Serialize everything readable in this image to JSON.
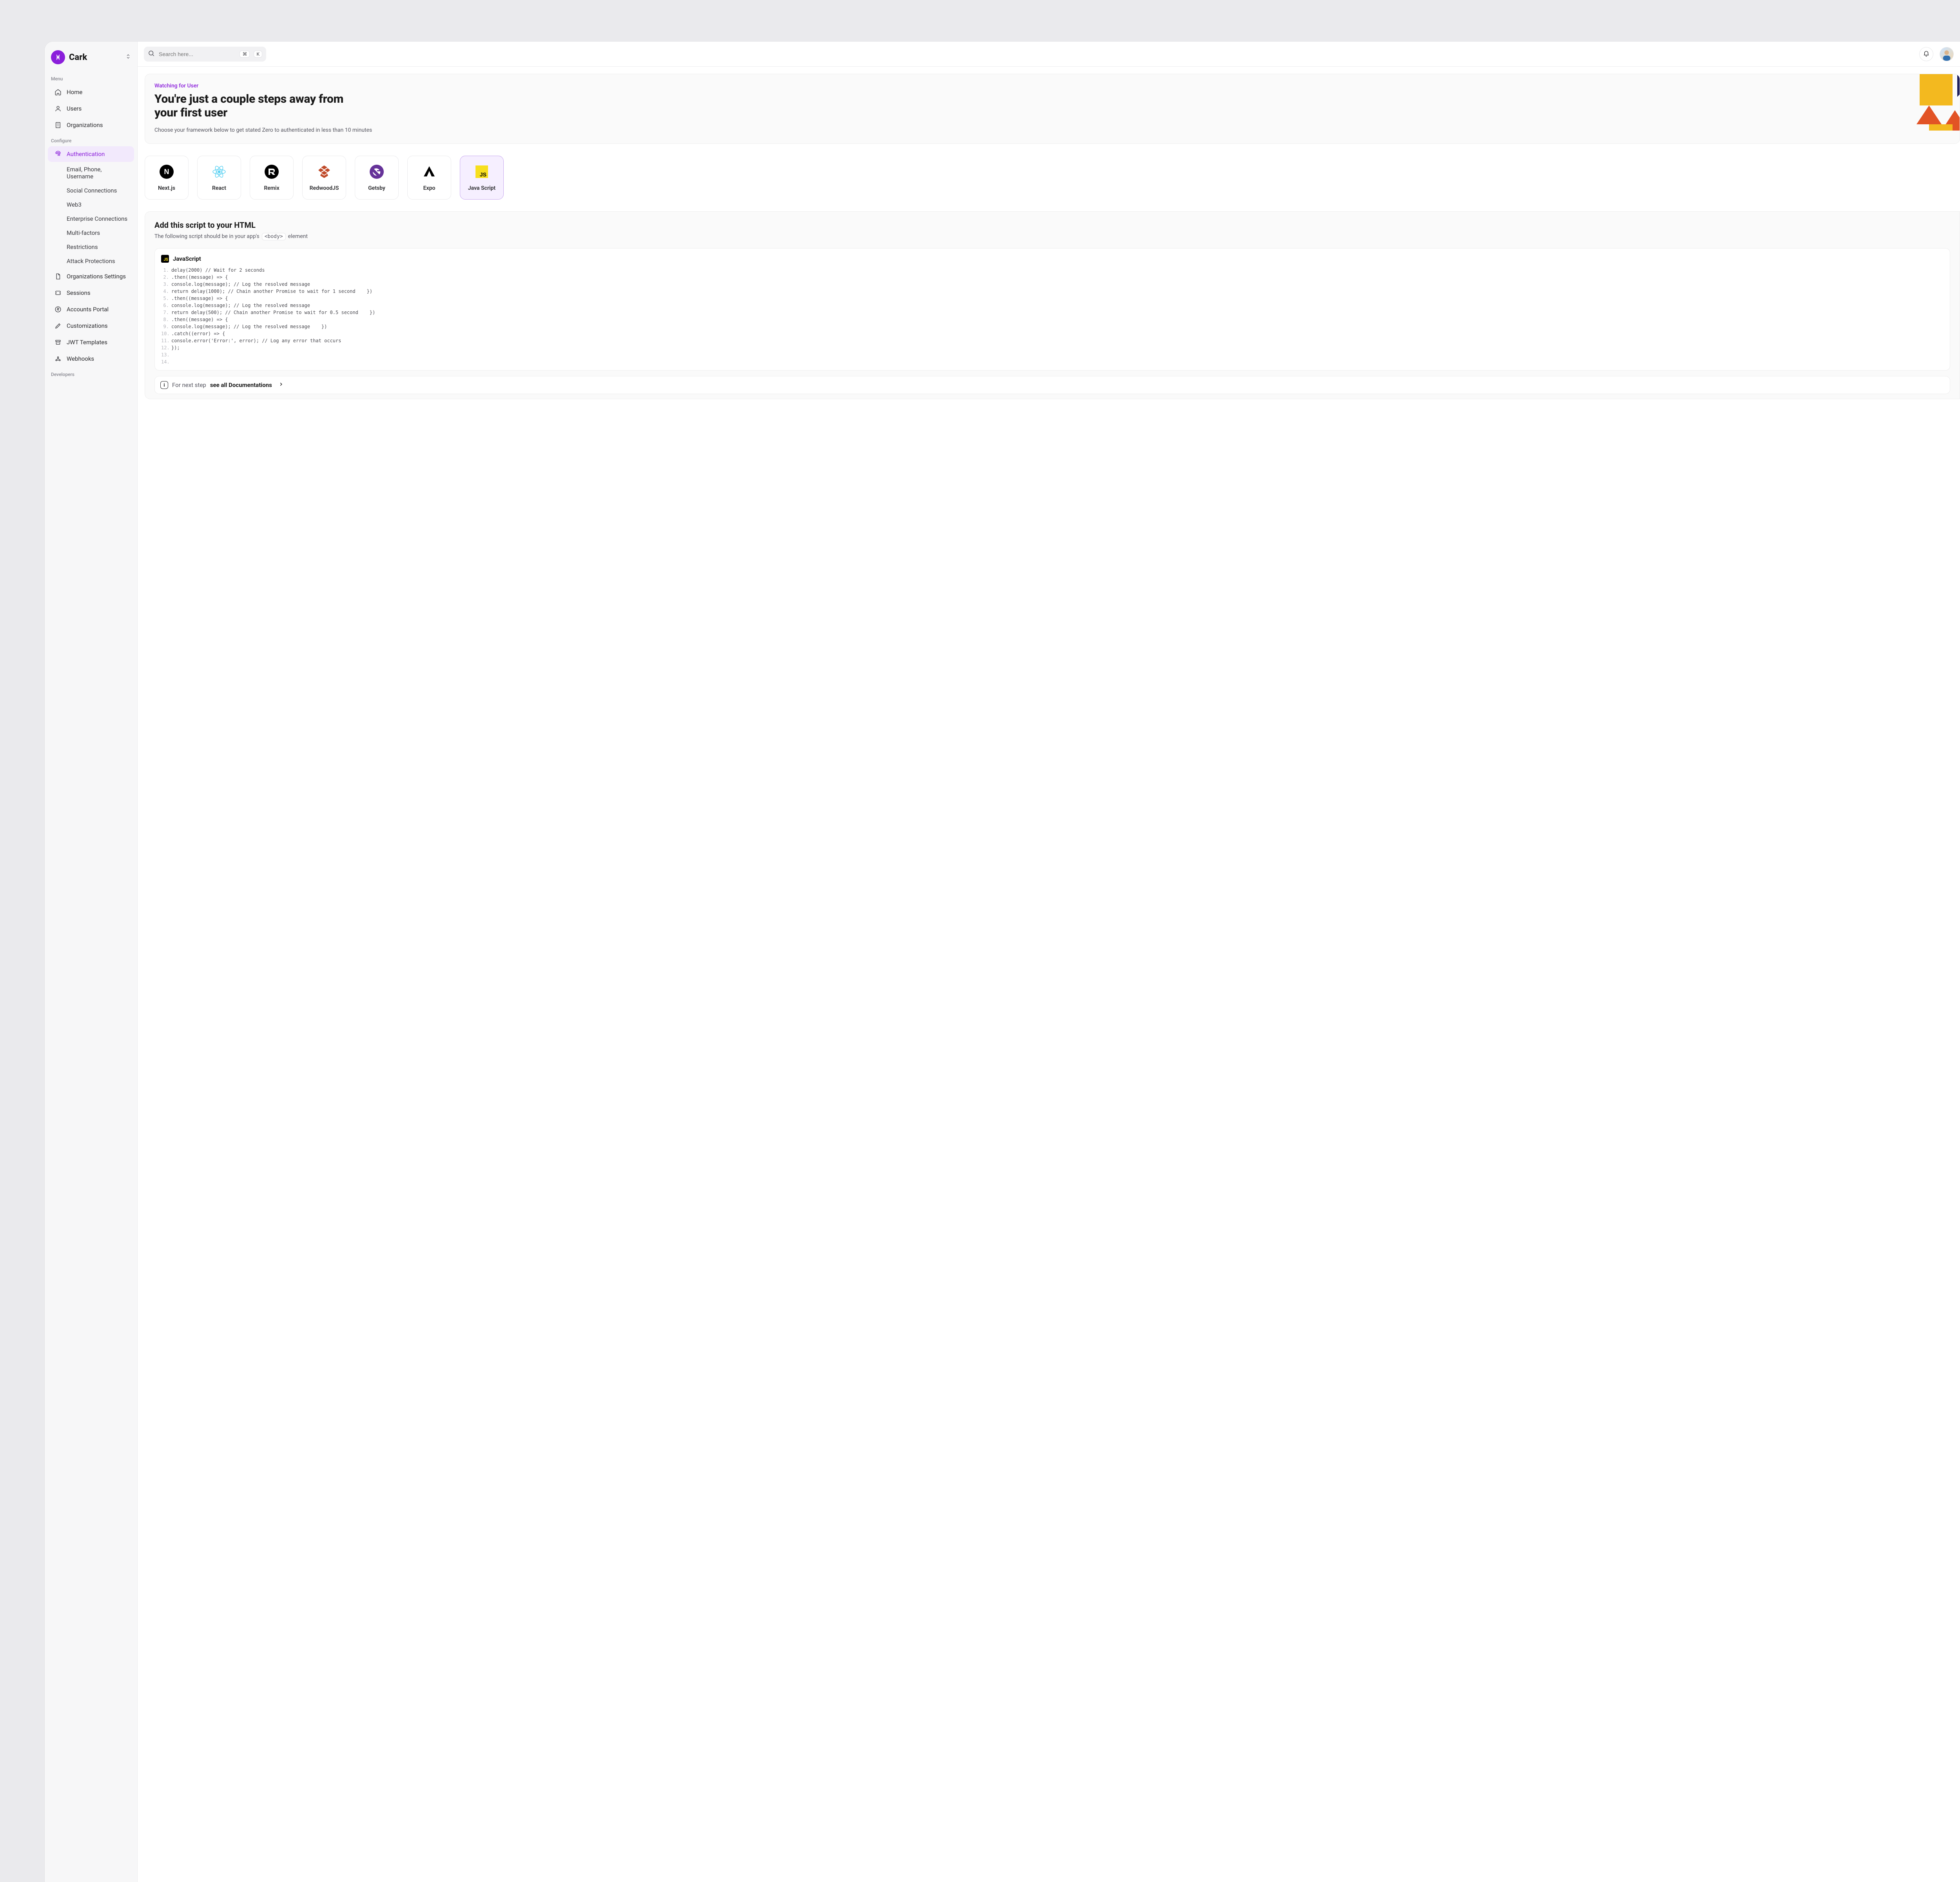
{
  "brand": {
    "name": "Cark"
  },
  "search": {
    "placeholder": "Search here...",
    "kbd_mod": "⌘",
    "kbd_key": "K"
  },
  "sidebar": {
    "section_menu": "Menu",
    "section_configure": "Configure",
    "section_developers": "Developers",
    "menu": [
      {
        "label": "Home"
      },
      {
        "label": "Users"
      },
      {
        "label": "Organizations"
      }
    ],
    "configure": [
      {
        "label": "Authentication",
        "active": true
      },
      {
        "label": "Organizations Settings"
      },
      {
        "label": "Sessions"
      },
      {
        "label": "Accounts Portal"
      },
      {
        "label": "Customizations"
      },
      {
        "label": "JWT Templates"
      },
      {
        "label": "Webhooks"
      }
    ],
    "auth_sub": [
      {
        "label": "Email, Phone, Username"
      },
      {
        "label": "Social Connections"
      },
      {
        "label": "Web3"
      },
      {
        "label": "Enterprise Connections"
      },
      {
        "label": "Multi-factors"
      },
      {
        "label": "Restrictions"
      },
      {
        "label": "Attack Protections"
      }
    ]
  },
  "hero": {
    "watching": "Watching for User",
    "title": "You're just a couple steps away from your first user",
    "subtitle": "Choose your framework below to get stated Zero to authenticated in less than 10 minutes"
  },
  "frameworks": [
    {
      "label": "Next.js"
    },
    {
      "label": "React"
    },
    {
      "label": "Remix"
    },
    {
      "label": "RedwoodJS"
    },
    {
      "label": "Getsby"
    },
    {
      "label": "Expo"
    },
    {
      "label": "Java Script",
      "selected": true
    }
  ],
  "code_panel": {
    "title": "Add this script to your HTML",
    "sub_prefix": "The following script should be in your app's",
    "sub_tag": "<body>",
    "sub_suffix": "element",
    "lang": "JavaScript",
    "lines": [
      "delay(2000) // Wait for 2 seconds",
      ".then((message) => {",
      "console.log(message); // Log the resolved message",
      "return delay(1000); // Chain another Promise to wait for 1 second    })",
      ".then((message) => {",
      "console.log(message); // Log the resolved message",
      "return delay(500); // Chain another Promise to wait for 0.5 second    })",
      ".then((message) => {",
      "console.log(message); // Log the resolved message    })",
      ".catch((error) => {",
      "console.error('Error:', error); // Log any error that occurs",
      "});",
      "",
      ""
    ]
  },
  "footer": {
    "prefix": "For next step",
    "link": "see all Documentations"
  }
}
